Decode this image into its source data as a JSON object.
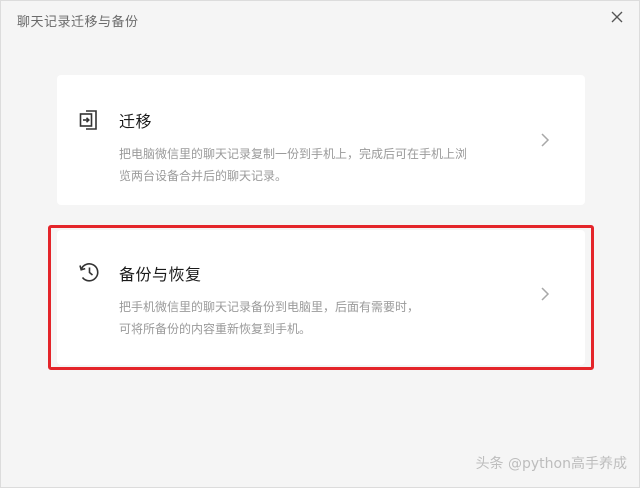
{
  "window": {
    "title": "聊天记录迁移与备份"
  },
  "options": [
    {
      "title": "迁移",
      "desc_lines": [
        "把电脑微信里的聊天记录复制一份到手机上，完成后可在手机上浏",
        "览两台设备合并后的聊天记录。"
      ],
      "icon": "migrate-icon"
    },
    {
      "title": "备份与恢复",
      "desc_lines": [
        "把手机微信里的聊天记录备份到电脑里，后面有需要时，",
        "可将所备份的内容重新恢复到手机。"
      ],
      "icon": "history-icon",
      "highlighted": true
    }
  ],
  "icons": {
    "close": "close-icon",
    "chevron": "chevron-right-icon"
  },
  "colors": {
    "highlight_border": "#e4252a",
    "background": "#f5f5f5",
    "card": "#ffffff"
  },
  "watermark": "头条 @python高手养成"
}
